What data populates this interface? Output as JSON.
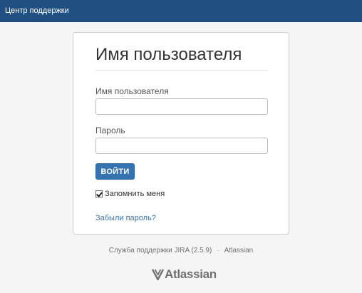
{
  "header": {
    "title": "Центр поддержки",
    "background_color": "#205081"
  },
  "login": {
    "heading": "Имя пользователя",
    "username_label": "Имя пользователя",
    "username_value": "",
    "password_label": "Пароль",
    "password_value": "",
    "submit_label": "ВОЙТИ",
    "remember_label": "Запомнить меня",
    "remember_checked": true,
    "forgot_link": "Забыли пароль?",
    "accent_color": "#3572b0"
  },
  "footer": {
    "product": "Служба поддержки JIRA (2.5.9)",
    "separator": "·",
    "vendor_link": "Atlassian"
  },
  "logo": {
    "text": "Atlassian",
    "icon": "atlassian-logo-icon"
  }
}
